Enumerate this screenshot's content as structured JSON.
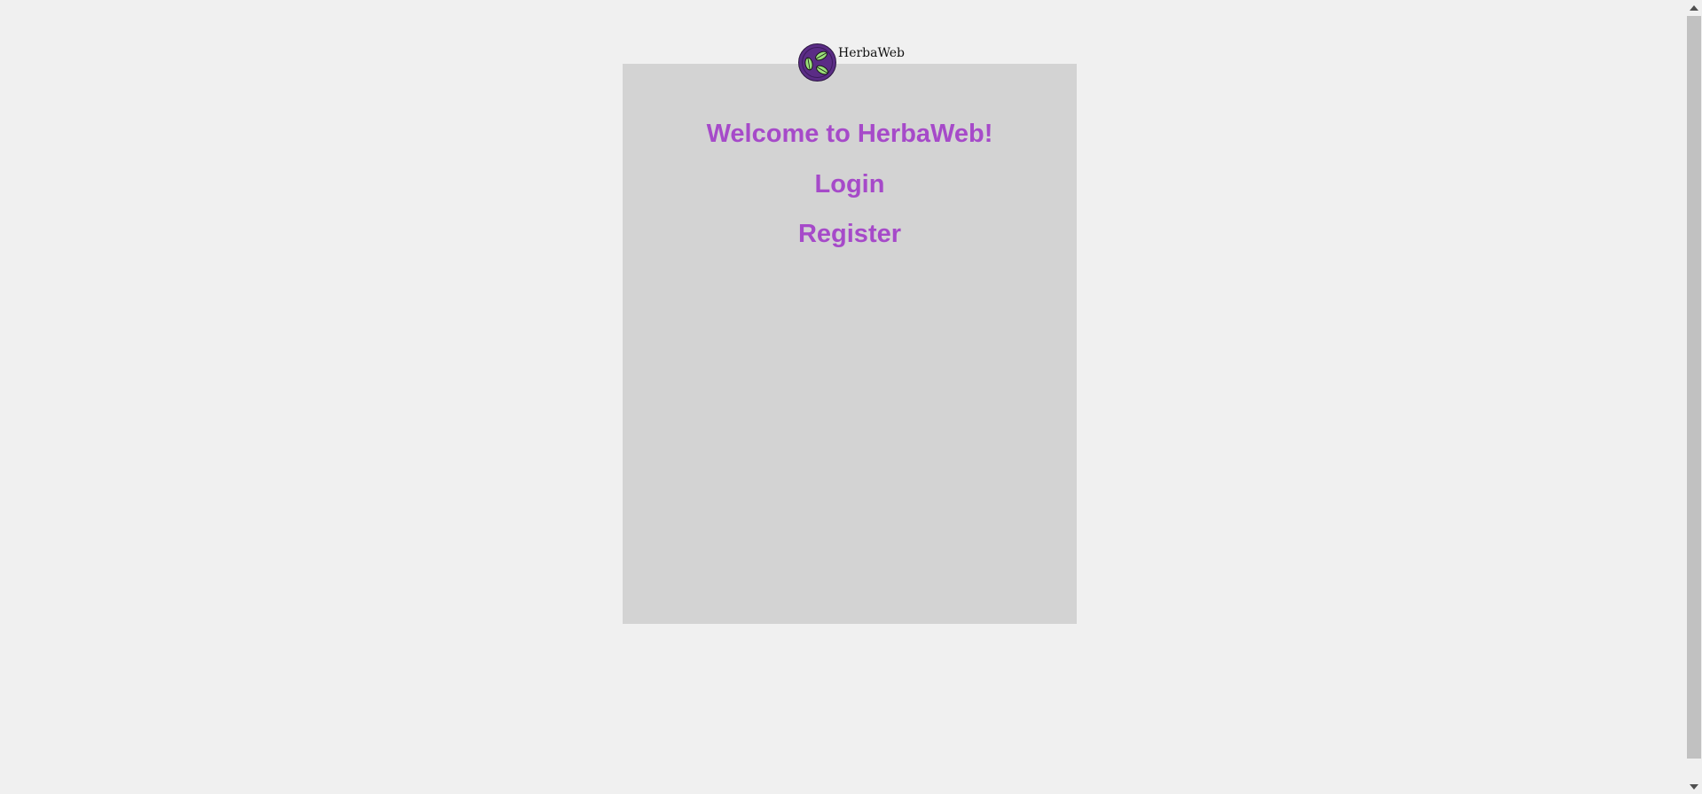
{
  "brand": {
    "name": "HerbaWeb",
    "logo_icon": "herb-leaf-logo-icon",
    "logo_color": "#5b2c86",
    "leaf_color": "#9be07a"
  },
  "main": {
    "heading": "Welcome to HerbaWeb!",
    "links": [
      {
        "label": "Login"
      },
      {
        "label": "Register"
      }
    ],
    "accent_color": "#a64ac9",
    "card_color": "#d3d3d3"
  },
  "scrollbar": {
    "up_icon": "scroll-up-arrow-icon",
    "down_icon": "scroll-down-arrow-icon"
  }
}
